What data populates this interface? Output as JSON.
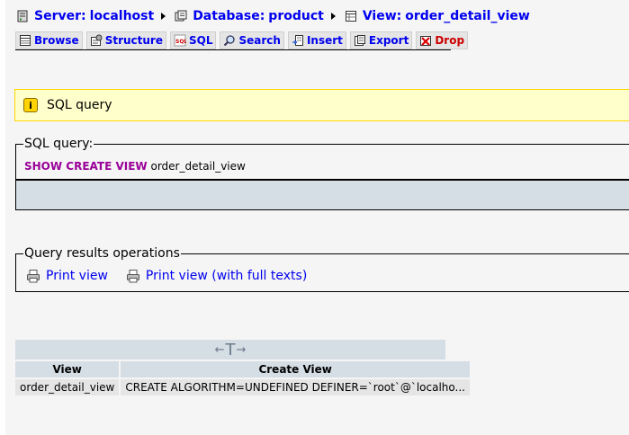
{
  "breadcrumb": {
    "server": {
      "label": "Server:",
      "value": "localhost"
    },
    "database": {
      "label": "Database:",
      "value": "product"
    },
    "view": {
      "label": "View:",
      "value": "order_detail_view"
    }
  },
  "tabs": [
    {
      "label": "Browse"
    },
    {
      "label": "Structure"
    },
    {
      "label": "SQL"
    },
    {
      "label": "Search"
    },
    {
      "label": "Insert"
    },
    {
      "label": "Export"
    },
    {
      "label": "Drop"
    }
  ],
  "notice": {
    "text": "SQL query"
  },
  "sql_query": {
    "legend": "SQL query:",
    "keyword": "SHOW CREATE VIEW",
    "identifier": "order_detail_view"
  },
  "query_results_operations": {
    "legend": "Query results operations",
    "print_view": "Print view",
    "print_view_full": "Print view (with full texts)"
  },
  "results_table": {
    "nav": {
      "left": "←",
      "t": "T",
      "right": "→"
    },
    "columns": [
      "View",
      "Create View"
    ],
    "rows": [
      [
        "order_detail_view",
        "CREATE ALGORITHM=UNDEFINED DEFINER=`root`@`localho..."
      ]
    ]
  },
  "colors": {
    "link": "#0000ee",
    "drop": "#cc0000",
    "sql_keyword": "#990099",
    "notice_bg": "#ffffcc",
    "table_header": "#d5dde5",
    "table_cell": "#e5e5e5"
  }
}
